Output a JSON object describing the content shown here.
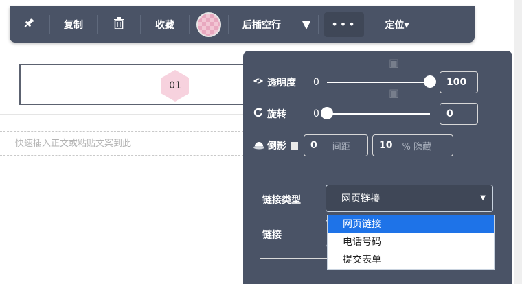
{
  "toolbar": {
    "pin_icon": "pin-icon",
    "copy_label": "复制",
    "delete_icon": "trash-icon",
    "collect_label": "收藏",
    "insert_empty_line_label": "后插空行",
    "dropdown_arrow": "▼",
    "more_label": "•••",
    "position_label": "定位▾"
  },
  "content": {
    "index_badge": "01",
    "paste_placeholder": "快速插入正文或粘贴文案到此"
  },
  "panel": {
    "opacity": {
      "icon": "eye-icon",
      "label": "透明度",
      "min": "0",
      "value": "100",
      "slider_fraction": 1.0
    },
    "rotate": {
      "icon": "rotate-icon",
      "label": "旋转",
      "min": "0",
      "value": "0",
      "slider_fraction": 0.0
    },
    "shadow": {
      "icon": "shadow-icon",
      "label": "倒影",
      "checked": false,
      "distance_value": "0",
      "distance_label": "间距",
      "percent_value": "10",
      "percent_label": "% 隐藏"
    },
    "link_type": {
      "label": "链接类型",
      "selected": "网页链接"
    },
    "link": {
      "label": "链接"
    },
    "options": [
      "网页链接",
      "电话号码",
      "提交表单"
    ]
  },
  "colors": {
    "panel_bg": "#4a5366",
    "accent": "#1e73e8",
    "swatch": "#f2c6d4"
  }
}
